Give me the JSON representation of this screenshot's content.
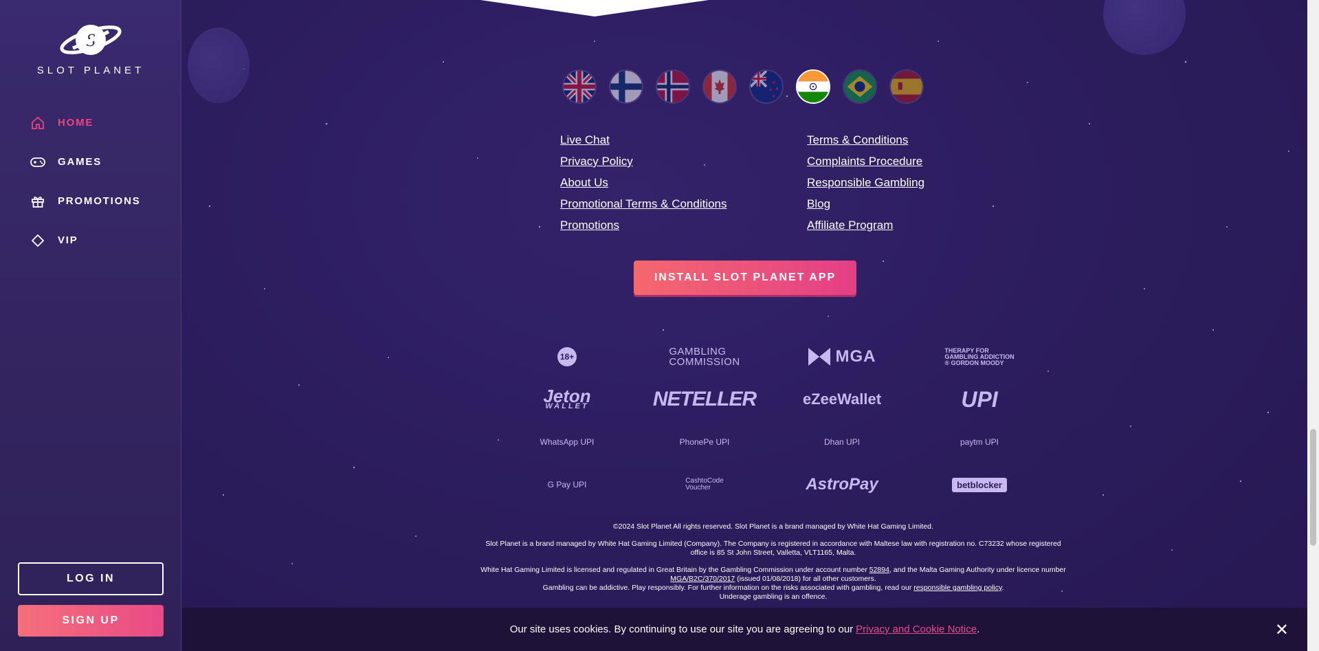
{
  "brand": {
    "name": "SLOT PLANET"
  },
  "nav": [
    {
      "label": "HOME",
      "icon": "home-icon",
      "active": true
    },
    {
      "label": "GAMES",
      "icon": "gamepad-icon"
    },
    {
      "label": "PROMOTIONS",
      "icon": "gift-icon"
    },
    {
      "label": "VIP",
      "icon": "diamond-icon"
    }
  ],
  "auth": {
    "login": "LOG IN",
    "signup": "SIGN UP"
  },
  "flags": [
    {
      "name": "uk",
      "active": false
    },
    {
      "name": "finland",
      "active": false
    },
    {
      "name": "norway",
      "active": false
    },
    {
      "name": "canada",
      "active": false
    },
    {
      "name": "new-zealand",
      "active": false
    },
    {
      "name": "india",
      "active": true
    },
    {
      "name": "brazil",
      "active": false
    },
    {
      "name": "spain",
      "active": false
    }
  ],
  "links": {
    "col1": [
      "Live Chat",
      "Privacy Policy",
      "About Us",
      "Promotional Terms & Conditions",
      "Promotions"
    ],
    "col2": [
      "Terms & Conditions",
      "Complaints Procedure",
      "Responsible Gambling",
      "Blog",
      "Affiliate Program"
    ]
  },
  "install_button": "INSTALL SLOT PLANET APP",
  "logos": {
    "age": "18+",
    "gc_line1": "GAMBLING",
    "gc_line2": "COMMISSION",
    "mga": "MGA",
    "gm_line1": "THERAPY FOR",
    "gm_line2": "GAMBLING ADDICTION",
    "gm_line3": "® GORDON MOODY",
    "jeton": "Jeton",
    "jeton_sub": "WALLET",
    "neteller": "NETELLER",
    "ezee": "eZeeWallet",
    "upi": "UPI",
    "whatsapp": "WhatsApp UPI",
    "phonepe": "PhonePe UPI",
    "dhan": "Dhan UPI",
    "paytm": "paytm UPI",
    "gpay": "G Pay UPI",
    "cashtocode_1": "CashtoCode",
    "cashtocode_2": "Voucher",
    "astropay": "AstroPay",
    "betblocker": "betblocker"
  },
  "legal": {
    "copyright": "©2024 Slot Planet All rights reserved. Slot Planet is a brand managed by White Hat Gaming Limited.",
    "company": "Slot Planet is a brand managed by White Hat Gaming Limited (Company). The Company is registered in accordance with Maltese law with registration no. C73232 whose registered office is 85 St John Street, Valletta, VLT1165, Malta.",
    "licence_a": "White Hat Gaming Limited is licensed and regulated in Great Britain by the Gambling Commission under account number ",
    "account_number": "52894",
    "licence_b": ", and the Malta Gaming Authority under licence number ",
    "mga_number": "MGA/B2C/370/2017",
    "licence_c": " (issued 01/08/2018) for all other customers.",
    "gamble_a": "Gambling can be addictive. Play responsibly. For further information on the risks associated with gambling, read our ",
    "gamble_link": "responsible gambling policy",
    "gamble_b": ".",
    "underage": "Underage gambling is an offence."
  },
  "cookie": {
    "text": "Our site uses cookies. By continuing to use our site you are agreeing to our",
    "link": "Privacy and Cookie Notice",
    "end": ".",
    "close": "✕"
  }
}
